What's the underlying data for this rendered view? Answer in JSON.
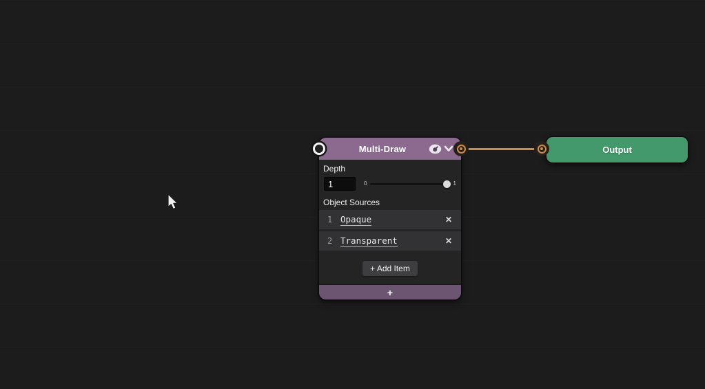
{
  "colors": {
    "canvas_bg": "#1c1c1d",
    "node_body": "#242425",
    "node_header_purple": "#8c6a8f",
    "node_footer_purple": "#6c5570",
    "output_green": "#44996c",
    "wire_orange": "#cc8c4d",
    "row_bg": "#323234"
  },
  "multi_draw_node": {
    "title": "Multi-Draw",
    "header_icons": [
      {
        "name": "eye-icon"
      },
      {
        "name": "chevron-down-icon"
      }
    ],
    "depth": {
      "label": "Depth",
      "value": "1",
      "slider_min_label": "0",
      "slider_max_label": "1",
      "slider_value": 1
    },
    "object_sources": {
      "label": "Object Sources",
      "items": [
        {
          "index": "1",
          "label": "Opaque",
          "remove_glyph": "✕"
        },
        {
          "index": "2",
          "label": "Transparent",
          "remove_glyph": "✕"
        }
      ],
      "add_item_label": "+ Add Item"
    },
    "footer_add_glyph": "+"
  },
  "output_node": {
    "title": "Output"
  }
}
